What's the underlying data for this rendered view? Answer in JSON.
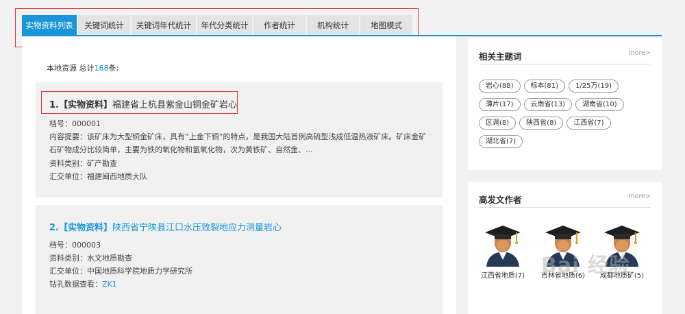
{
  "tabs": [
    {
      "label": "实物资料列表",
      "active": true
    },
    {
      "label": "关键词统计",
      "active": false
    },
    {
      "label": "关键词年代统计",
      "active": false
    },
    {
      "label": "年代分类统计",
      "active": false
    },
    {
      "label": "作者统计",
      "active": false
    },
    {
      "label": "机构统计",
      "active": false
    },
    {
      "label": "地图模式",
      "active": false
    }
  ],
  "summary": {
    "prefix": "本地资源 总计",
    "count": "168",
    "suffix": "条;"
  },
  "results": [
    {
      "index": "1.",
      "tag": "【实物资料】",
      "title": "福建省上杭县紫金山铜金矿岩心",
      "archive": "档号：000001",
      "abstract": "内容提要：该矿床为大型铜金矿床，具有“上金下铜”的特点，是我国大陆首例高硫型浅成低温热液矿床。矿床金矿石矿物成分比较简单，主要为铁的氧化物和氢氧化物，次为黄铁矿、自然金、...",
      "category": "资料类别：矿产勘查",
      "unit": "汇交单位：福建闽西地质大队"
    },
    {
      "index": "2.",
      "tag": "【实物资料】",
      "title": "陕西省宁陕县江口水压致裂地应力测量岩心",
      "archive": "档号：000003",
      "category": "资料类别：水文地质勘查",
      "unit": "汇交单位：中国地质科学院地质力学研究所",
      "drill_label": "钻孔数据查看：",
      "drill_link": "ZK1"
    }
  ],
  "related": {
    "title": "相关主题词",
    "more": "more>",
    "keywords": [
      "岩心(88)",
      "标本(81)",
      "1/25万(19)",
      "薄片(17)",
      "云南省(13)",
      "湖南省(10)",
      "区调(8)",
      "陕西省(8)",
      "江西省(7)",
      "湖北省(7)"
    ]
  },
  "authors": {
    "title": "高发文作者",
    "more": "more>",
    "items": [
      "江西省地质(7)",
      "吉林省地质(6)",
      "成都地质矿(5)"
    ]
  },
  "watermark": "Bai 经验",
  "colors": {
    "accent": "#1a95d9",
    "highlight_box": "#e5323e"
  }
}
